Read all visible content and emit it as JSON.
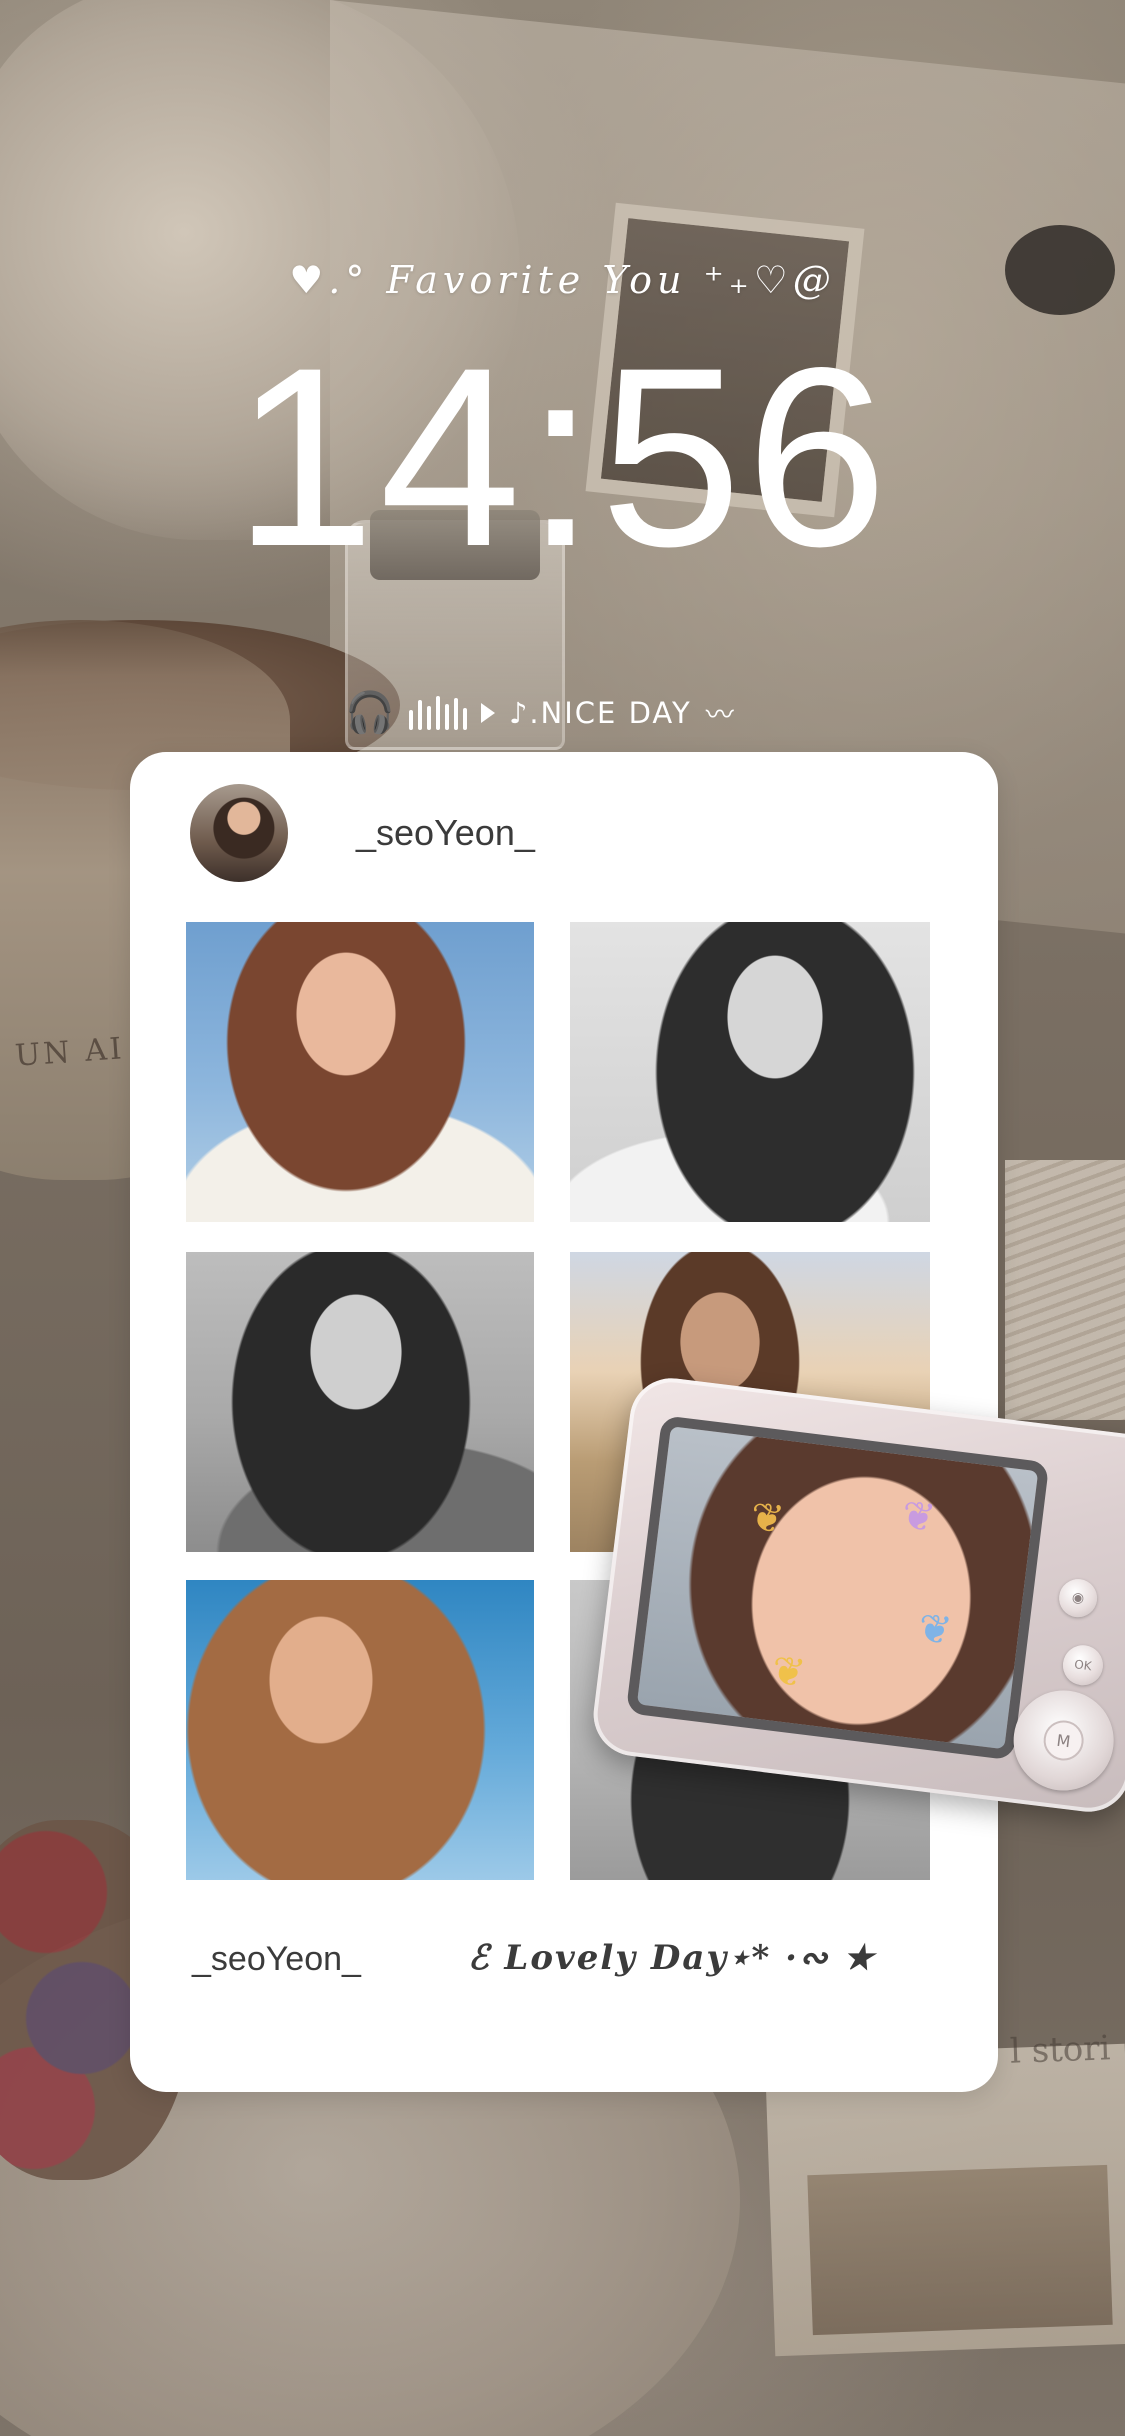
{
  "lockscreen": {
    "tagline": "♥.° Favorite You ⁺₊♡@",
    "time": "14:56",
    "now_playing": {
      "headphones_icon": "headphones-icon",
      "play_icon": "play-icon",
      "text": "♪.NICE DAY",
      "wave": "〰"
    }
  },
  "widget": {
    "profile_name": "_seoYeon_",
    "photos": [
      "photo-1",
      "photo-2",
      "photo-3",
      "photo-4",
      "photo-5",
      "photo-6"
    ],
    "footer_name": "_seoYeon_",
    "footer_tag": "ℰ Lovely Day⋆* ·∾ ★"
  },
  "camera_sticker": {
    "button_labels": [
      "◉",
      "OK"
    ],
    "dpad_label": "M"
  }
}
